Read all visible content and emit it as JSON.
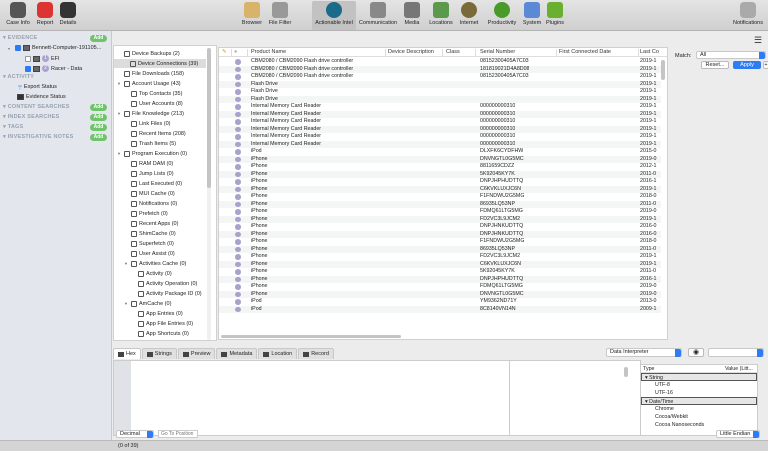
{
  "toolbar": {
    "left": [
      {
        "label": "Case Info",
        "icon": "briefcase-icon"
      },
      {
        "label": "Report",
        "icon": "report-icon"
      },
      {
        "label": "Details",
        "icon": "gauge-icon"
      }
    ],
    "center": [
      {
        "label": "Browser",
        "icon": "folder-icon"
      },
      {
        "label": "File Filter",
        "icon": "filter-icon"
      },
      {
        "label": "Actionable Intel",
        "icon": "radar-icon",
        "active": true
      },
      {
        "label": "Communication",
        "icon": "microphone-icon"
      },
      {
        "label": "Media",
        "icon": "camera-icon"
      },
      {
        "label": "Locations",
        "icon": "map-icon"
      },
      {
        "label": "Internet",
        "icon": "globe-icon"
      },
      {
        "label": "Productivity",
        "icon": "clock-icon"
      },
      {
        "label": "System",
        "icon": "system-icon"
      },
      {
        "label": "Plugins",
        "icon": "puzzle-icon"
      }
    ],
    "notifications": "Notifications"
  },
  "sidebar": {
    "evidence": "EVIDENCE",
    "add": "Add",
    "computer": "Bennett-Computer-191105...",
    "volumes": [
      {
        "num": "1",
        "label": "EFI",
        "checked": false
      },
      {
        "num": "2",
        "label": "Racer - Data",
        "checked": true
      }
    ],
    "activity": "ACTIVITY",
    "export_status": "Export Status",
    "evidence_status": "Evidence Status",
    "content_searches": "CONTENT SEARCHES",
    "index_searches": "INDEX SEARCHES",
    "tags": "TAGS",
    "notes": "INVESTIGATIVE NOTES"
  },
  "categories": [
    {
      "label": "Device Backups (2)",
      "level": 0
    },
    {
      "label": "Device Connections (39)",
      "level": 0,
      "selected": true
    },
    {
      "label": "File Downloads (158)",
      "level": 0
    },
    {
      "label": "Account Usage (43)",
      "level": 0,
      "expanded": true
    },
    {
      "label": "Top Contacts (35)",
      "level": 1
    },
    {
      "label": "User Accounts (8)",
      "level": 1
    },
    {
      "label": "File Knowledge (213)",
      "level": 0,
      "expanded": true
    },
    {
      "label": "Link Files (0)",
      "level": 1
    },
    {
      "label": "Recent Items (208)",
      "level": 1
    },
    {
      "label": "Trash Items (5)",
      "level": 1
    },
    {
      "label": "Program Execution (0)",
      "level": 0,
      "expanded": true
    },
    {
      "label": "RAM DAM (0)",
      "level": 1
    },
    {
      "label": "Jump Lists (0)",
      "level": 1
    },
    {
      "label": "Last Executed (0)",
      "level": 1
    },
    {
      "label": "MUI Cache (0)",
      "level": 1
    },
    {
      "label": "Notifications (0)",
      "level": 1
    },
    {
      "label": "Prefetch (0)",
      "level": 1
    },
    {
      "label": "Recent Apps (0)",
      "level": 1
    },
    {
      "label": "ShimCache (0)",
      "level": 1
    },
    {
      "label": "Superfetch (0)",
      "level": 1
    },
    {
      "label": "User Assist (0)",
      "level": 1
    },
    {
      "label": "Activities Cache (0)",
      "level": 1,
      "expanded": true
    },
    {
      "label": "Activity (0)",
      "level": 2
    },
    {
      "label": "Activity Operation (0)",
      "level": 2
    },
    {
      "label": "Activity Package ID (0)",
      "level": 2
    },
    {
      "label": "AmCache (0)",
      "level": 1,
      "expanded": true
    },
    {
      "label": "App Entries (0)",
      "level": 2
    },
    {
      "label": "App File Entries (0)",
      "level": 2
    },
    {
      "label": "App Shortcuts (0)",
      "level": 2
    }
  ],
  "table": {
    "columns": [
      "Product Name",
      "Device Description",
      "Class",
      "Serial Number",
      "First Connected Date",
      "Last Co"
    ],
    "rows": [
      [
        "CBM2080 / CBM2090 Flash drive controller",
        "08152300405A7C03",
        "2019-1"
      ],
      [
        "CBM2080 / CBM2090 Flash drive controller",
        "181819021D4A8D08",
        "2019-1"
      ],
      [
        "CBM2080 / CBM2090 Flash drive controller",
        "08152300405A7C03",
        "2019-1"
      ],
      [
        "Flash Drive",
        "",
        "2019-1"
      ],
      [
        "Flash Drive",
        "",
        "2019-1"
      ],
      [
        "Flash Drive",
        "",
        "2019-1"
      ],
      [
        "Internal Memory Card Reader",
        "000000000310",
        "2019-1"
      ],
      [
        "Internal Memory Card Reader",
        "000000000310",
        "2019-1"
      ],
      [
        "Internal Memory Card Reader",
        "000000000310",
        "2019-1"
      ],
      [
        "Internal Memory Card Reader",
        "000000000310",
        "2019-1"
      ],
      [
        "Internal Memory Card Reader",
        "000000000310",
        "2019-1"
      ],
      [
        "Internal Memory Card Reader",
        "000000000310",
        "2019-1"
      ],
      [
        "iPod",
        "DLXFK6CYDFHW",
        "2015-0"
      ],
      [
        "iPhone",
        "DNVNGTL0G5MC",
        "2019-0"
      ],
      [
        "iPhone",
        "8811659CDZZ",
        "2012-1"
      ],
      [
        "iPhone",
        "5K92045KY7K",
        "2011-0"
      ],
      [
        "iPhone",
        "DNPJHPHUDTTQ",
        "2016-1"
      ],
      [
        "iPhone",
        "C6KVKLUXJC6N",
        "2019-1"
      ],
      [
        "iPhone",
        "F1FNDWU2G5MG",
        "2018-0"
      ],
      [
        "iPhone",
        "86935LQ53NP",
        "2011-0"
      ],
      [
        "iPhone",
        "FDMQ61LTG5MG",
        "2019-0"
      ],
      [
        "iPhone",
        "FD2VC3L9JCM2",
        "2019-1"
      ],
      [
        "iPhone",
        "DNPJHNKUDTTQ",
        "2016-0"
      ],
      [
        "iPhone",
        "DNPJHNKUDTTQ",
        "2016-0"
      ],
      [
        "iPhone",
        "F1FNDWU2G5MG",
        "2018-0"
      ],
      [
        "iPhone",
        "86935LQ53NP",
        "2011-0"
      ],
      [
        "iPhone",
        "FD2VC3L9JCM2",
        "2019-1"
      ],
      [
        "iPhone",
        "C6KVKLUXJC6N",
        "2019-1"
      ],
      [
        "iPhone",
        "5K92045KY7K",
        "2011-0"
      ],
      [
        "iPhone",
        "DNPJHPHUDTTQ",
        "2016-1"
      ],
      [
        "iPhone",
        "FDMQ61LTG5MG",
        "2019-0"
      ],
      [
        "iPhone",
        "DNVNGTL0G5MC",
        "2019-0"
      ],
      [
        "iPod",
        "YM9362ND71Y",
        "2013-0"
      ],
      [
        "iPod",
        "8C8140VN14N",
        "2009-1"
      ]
    ]
  },
  "filter": {
    "match_label": "Match:",
    "match_value": "All",
    "reset": "Reset...",
    "apply": "Apply",
    "plus": "+"
  },
  "bottom": {
    "tabs": [
      "Hex",
      "Strings",
      "Preview",
      "Metadata",
      "Location",
      "Record"
    ],
    "interpreter": "Data Interpreter",
    "format": "Decimal",
    "goto_placeholder": "Go To Position",
    "endian": "Little Endian",
    "interp_cols": [
      "Type",
      "Value (Litt..."
    ],
    "interp_groups": [
      {
        "name": "String",
        "items": [
          "UTF-8",
          "UTF-16"
        ]
      },
      {
        "name": "Date/Time",
        "items": [
          "Chrome",
          "Cocoa/Webkit",
          "Cocoa Nanoseconds"
        ]
      }
    ]
  },
  "status": "(0 of 39)",
  "colors": {
    "accent": "#2d7cf6",
    "add": "#6fc36a",
    "badge": "#a9a2cf",
    "sidebar": "#e3e7ed"
  }
}
